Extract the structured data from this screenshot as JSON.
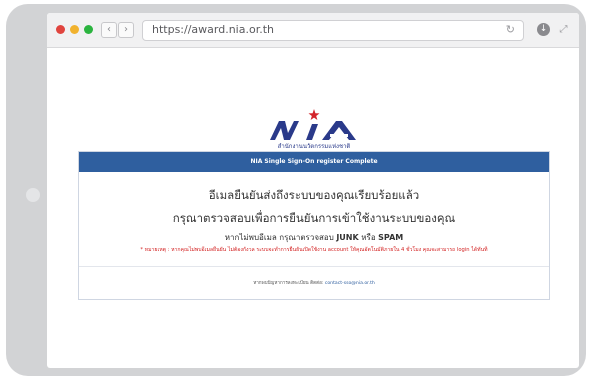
{
  "browser": {
    "url": "https://award.nia.or.th",
    "back_icon": "chevron-left",
    "forward_icon": "chevron-right",
    "reload_icon": "reload",
    "download_icon": "download",
    "extension_icon": "extension"
  },
  "logo": {
    "subtitle": "สำนักงานนวัตกรรมแห่งชาติ"
  },
  "card": {
    "header": "NIA Single Sign-On register Complete",
    "line1": "อีเมลยืนยันส่งถึงระบบของคุณเรียบร้อยแล้ว",
    "line2": "กรุณาตรวจสอบเพื่อการยืนยันการเข้าใช้งานระบบของคุณ",
    "line3_prefix": "หากไม่พบอีเมล กรุณาตรวจสอบ",
    "junk": "JUNK",
    "or": "หรือ",
    "spam": "SPAM",
    "note": "* หมายเหตุ : หากคุณไม่พบอีเมลยืนยัน ไม่ต้องกังวล ระบบจะทำการยืนยันเปิดใช้งาน account ให้คุณอัตโนมัติภายใน 4 ชั่วโมง คุณจะสามารถ login ได้ทันที",
    "footer_prefix": "หากพบปัญหาการลงทะเบียน ติดต่อ:",
    "footer_email": "contact-sso@nia.or.th"
  },
  "colors": {
    "header_blue": "#2f5f9f",
    "note_red": "#d32222",
    "logo_navy": "#2a3a8a",
    "logo_star": "#d3232a"
  }
}
